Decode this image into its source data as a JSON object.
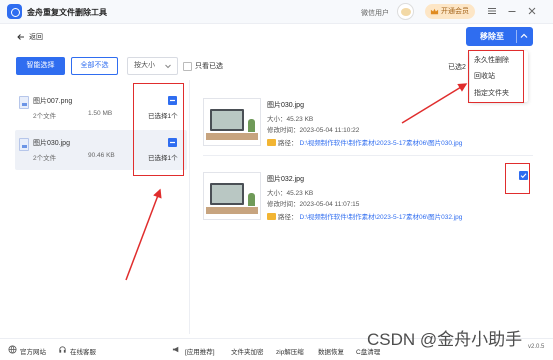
{
  "window": {
    "title": "金舟重复文件删除工具",
    "user_name": "微信用户",
    "vip_button": "开通会员"
  },
  "nav": {
    "back_label": "返回",
    "move_button": "移除至"
  },
  "toolbar": {
    "smart_select": "智能选择",
    "deselect_all": "全部不选",
    "sort_value": "按大小",
    "only_selected": "只看已选",
    "selected_count": "已选2"
  },
  "move_menu": {
    "items": [
      "永久性删除",
      "回收站",
      "指定文件夹"
    ]
  },
  "groups": [
    {
      "name": "图片007.png",
      "count": "2个文件",
      "size": "1.50 MB",
      "selected": "已选择1个",
      "checked": true
    },
    {
      "name": "图片030.jpg",
      "count": "2个文件",
      "size": "90.46 KB",
      "selected": "已选择1个",
      "checked": true
    }
  ],
  "files": [
    {
      "name": "图片030.jpg",
      "size": "大小：45.23 KB",
      "modified": "修改时间：2023-05-04 11:10:22",
      "path_label": "路径：",
      "path_value": "D:\\视频制作软件\\制作素材\\2023-5-17素材06\\图片030.jpg",
      "checked": false
    },
    {
      "name": "图片032.jpg",
      "size": "大小：45.23 KB",
      "modified": "修改时间：2023-05-04 11:07:15",
      "path_label": "路径：",
      "path_value": "D:\\视频制作软件\\制作素材\\2023-5-17素材06\\图片032.jpg",
      "checked": true
    }
  ],
  "statusbar": {
    "official_site": "官方网站",
    "online_support": "在线客服",
    "recommend": "[应用推荐]",
    "links": [
      "文件夹加密",
      "zip解压缩",
      "数据恢复",
      "C盘清理"
    ],
    "version": "v2.0.5"
  },
  "watermark": "CSDN @金舟小助手",
  "colors": {
    "accent": "#2f6df0",
    "highlight": "#e02d2d"
  }
}
